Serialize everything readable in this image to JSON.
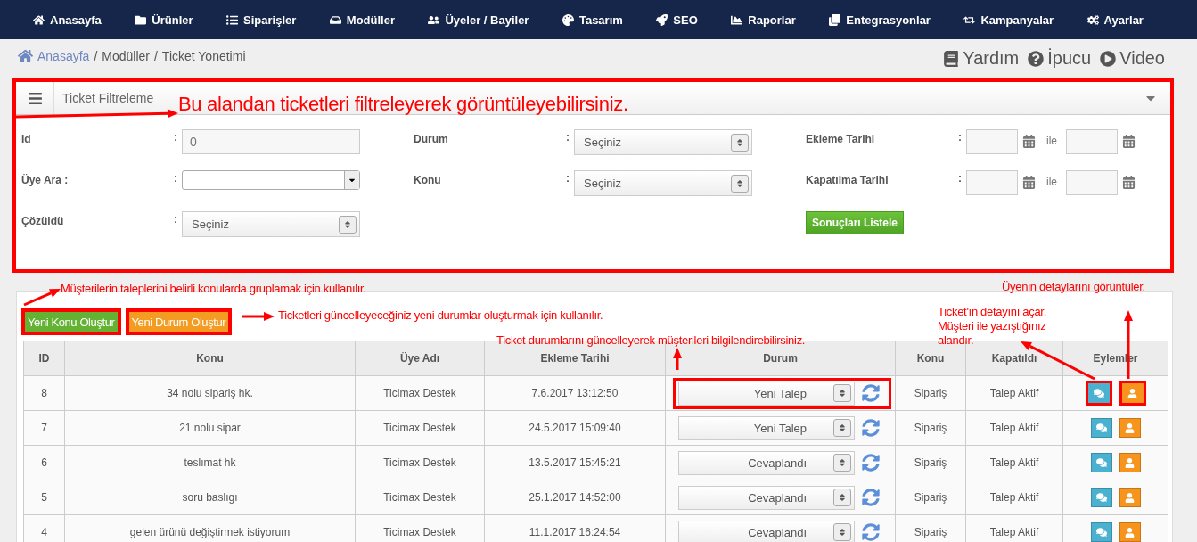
{
  "nav": [
    {
      "label": "Anasayfa"
    },
    {
      "label": "Ürünler"
    },
    {
      "label": "Siparişler"
    },
    {
      "label": "Modüller"
    },
    {
      "label": "Üyeler / Bayiler"
    },
    {
      "label": "Tasarım"
    },
    {
      "label": "SEO"
    },
    {
      "label": "Raporlar"
    },
    {
      "label": "Entegrasyonlar"
    },
    {
      "label": "Kampanyalar"
    },
    {
      "label": "Ayarlar"
    }
  ],
  "breadcrumb": {
    "home": "Anasayfa",
    "sep": "/",
    "rest": [
      "Modüller",
      "Ticket Yonetimi"
    ]
  },
  "help_links": [
    {
      "label": "Yardım"
    },
    {
      "label": "İpucu"
    },
    {
      "label": "Video"
    }
  ],
  "filter_panel": {
    "title": "Ticket Filtreleme",
    "highlighted": true,
    "colon": ":",
    "fields": [
      {
        "label": "Id",
        "kind": "text",
        "value": "0"
      },
      {
        "label": "Durum",
        "kind": "select",
        "value": "Seçiniz"
      },
      {
        "label": "Ekleme Tarihi",
        "kind": "date_range",
        "separator": "ile"
      },
      {
        "label": "Üye Ara :",
        "kind": "combo"
      },
      {
        "label": "Konu",
        "kind": "select",
        "value": "Seçiniz"
      },
      {
        "label": "Kapatılma Tarihi",
        "kind": "date_range",
        "separator": "ile"
      },
      {
        "label": "Çözüldü",
        "kind": "select",
        "value": "Seçiniz"
      }
    ],
    "submit": "Sonuçları Listele"
  },
  "buttons": [
    {
      "label": "Yeni Konu Oluştur",
      "kind": "green",
      "highlighted": true
    },
    {
      "label": "Yeni Durum Oluştur",
      "kind": "orange",
      "highlighted": true
    }
  ],
  "table": {
    "columns": [
      "ID",
      "Konu",
      "Üye Adı",
      "Ekleme Tarihi",
      "Durum",
      "Konu",
      "Kapatıldı",
      "Eylemler"
    ],
    "rows": [
      {
        "id": "8",
        "konu": "34 nolu sipariş hk.",
        "uye": "Ticimax Destek",
        "tarih": "7.6.2017 13:12:50",
        "durum": "Yeni Talep",
        "konu_2": "Sipariş",
        "kapatildi": "Talep Aktif",
        "highlighted": true
      },
      {
        "id": "7",
        "konu": "21 nolu sipar",
        "uye": "Ticimax Destek",
        "tarih": "24.5.2017 15:09:40",
        "durum": "Yeni Talep",
        "konu_2": "Sipariş",
        "kapatildi": "Talep Aktif",
        "highlighted": false
      },
      {
        "id": "6",
        "konu": "teslımat hk",
        "uye": "Ticimax Destek",
        "tarih": "13.5.2017 15:45:21",
        "durum": "Cevaplandı",
        "konu_2": "Sipariş",
        "kapatildi": "Talep Aktif",
        "highlighted": false
      },
      {
        "id": "5",
        "konu": "soru baslıgı",
        "uye": "Ticimax Destek",
        "tarih": "25.1.2017 14:52:00",
        "durum": "Cevaplandı",
        "konu_2": "Sipariş",
        "kapatildi": "Talep Aktif",
        "highlighted": false
      },
      {
        "id": "4",
        "konu": "gelen ürünü değiştirmek istiyorum",
        "uye": "Ticimax Destek",
        "tarih": "11.1.2017 16:24:54",
        "durum": "Cevaplandı",
        "konu_2": "Sipariş",
        "kapatildi": "Talep Aktif",
        "highlighted": false
      }
    ]
  },
  "annotations": [
    {
      "text": "Bu alandan ticketleri filtreleyerek görüntüleyebilirsiniz."
    },
    {
      "text": "Müşterilerin taleplerini belirli konularda gruplamak için kullanılır."
    },
    {
      "text": "Ticketleri güncelleyeceğiniz yeni durumlar oluşturmak için kullanılır."
    },
    {
      "text": "Ticket durumlarını güncelleyerek müşterileri bilgilendirebilirsiniz."
    },
    {
      "text": "Üyenin detaylarını görüntüler."
    },
    {
      "text": "Ticket'ın detayını açar. Müşteri ile yazıştığınız alandır."
    }
  ]
}
